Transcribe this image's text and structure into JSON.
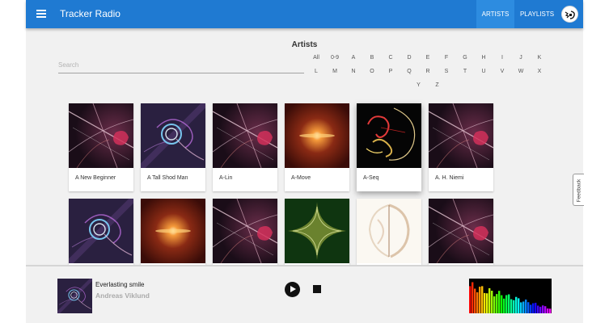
{
  "app": {
    "title": "Tracker Radio"
  },
  "nav": {
    "artists": "ARTISTS",
    "playlists": "PLAYLISTS"
  },
  "page": {
    "title": "Artists"
  },
  "search": {
    "placeholder": "Search",
    "value": ""
  },
  "alphabet": [
    [
      "All",
      "0-9",
      "A",
      "B",
      "C",
      "D",
      "E",
      "F",
      "G",
      "H",
      "I",
      "J",
      "K"
    ],
    [
      "L",
      "M",
      "N",
      "O",
      "P",
      "Q",
      "R",
      "S",
      "T",
      "U",
      "V",
      "W",
      "X"
    ],
    [
      "Y",
      "Z"
    ]
  ],
  "artists": [
    {
      "name": "A New Beginner",
      "art": "streak"
    },
    {
      "name": "A Tall Shod Man",
      "art": "swirl"
    },
    {
      "name": "A-Lin",
      "art": "streak"
    },
    {
      "name": "A-Move",
      "art": "glow"
    },
    {
      "name": "A-Seq",
      "art": "curl"
    },
    {
      "name": "A. H. Niemi",
      "art": "streak"
    },
    {
      "name": "",
      "art": "swirl"
    },
    {
      "name": "",
      "art": "glow"
    },
    {
      "name": "",
      "art": "streak"
    },
    {
      "name": "",
      "art": "star"
    },
    {
      "name": "",
      "art": "pale"
    },
    {
      "name": "",
      "art": "streak"
    }
  ],
  "player": {
    "title": "Everlasting smile",
    "artist": "Andreas Viklund",
    "cover_art": "swirl"
  },
  "feedback": {
    "label": "Feedback"
  },
  "colors": {
    "appbar": "#1f7ad2",
    "nav_active": "#2d8ce0",
    "background": "#f1f1f1"
  }
}
